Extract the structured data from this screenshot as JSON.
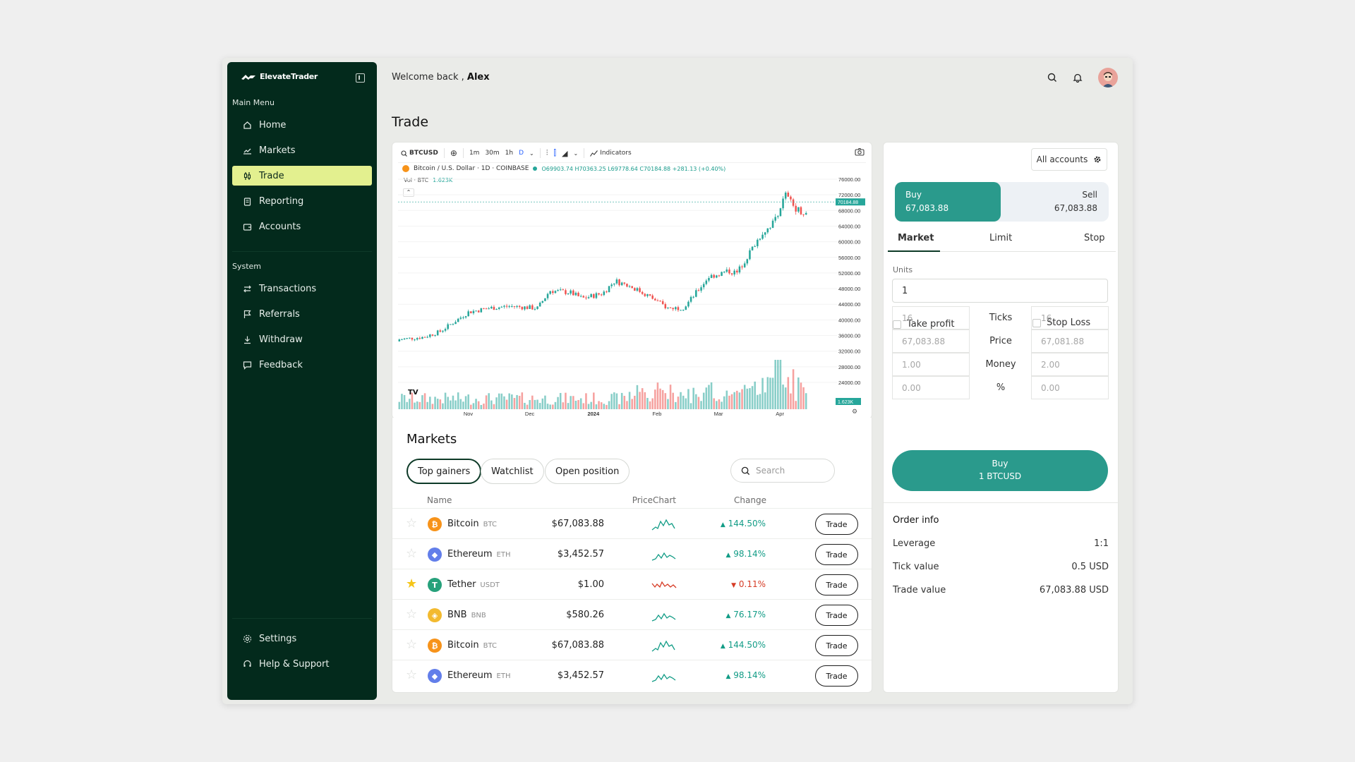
{
  "app": {
    "brand": "ElevateTrader"
  },
  "sidebar": {
    "main_menu_title": "Main Menu",
    "main_items": [
      {
        "label": "Home",
        "icon": "home-icon",
        "active": false
      },
      {
        "label": "Markets",
        "icon": "chart-line-icon",
        "active": false
      },
      {
        "label": "Trade",
        "icon": "candlestick-icon",
        "active": true
      },
      {
        "label": "Reporting",
        "icon": "clipboard-icon",
        "active": false
      },
      {
        "label": "Accounts",
        "icon": "wallet-icon",
        "active": false
      }
    ],
    "system_title": "System",
    "system_items": [
      {
        "label": "Transactions",
        "icon": "transfer-arrows-icon"
      },
      {
        "label": "Referrals",
        "icon": "flag-icon"
      },
      {
        "label": "Withdraw",
        "icon": "download-icon"
      },
      {
        "label": "Feedback",
        "icon": "message-icon"
      }
    ],
    "bottom_items": [
      {
        "label": "Settings",
        "icon": "gear-icon"
      },
      {
        "label": "Help & Support",
        "icon": "headset-icon"
      }
    ]
  },
  "topbar": {
    "welcome_prefix": "Welcome back ,",
    "user_name": "Alex"
  },
  "page": {
    "title": "Trade"
  },
  "chart": {
    "symbol": "BTCUSD",
    "intervals": [
      "1m",
      "30m",
      "1h",
      "D"
    ],
    "active_interval": "D",
    "indicators_label": "Indicators",
    "pair_name": "Bitcoin / U.S. Dollar · 1D · COINBASE",
    "ohlc": "O69903.74 H70363.25 L69778.64 C70184.88 +281.13 (+0.40%)",
    "volume_label": "Vol · BTC",
    "volume_value": "1.623K",
    "current_price_tag": "70184.88",
    "volume_tag": "1.623K",
    "x_ticks": [
      "Nov",
      "Dec",
      "2024",
      "Feb",
      "Mar",
      "Apr"
    ],
    "y_ticks": [
      "76000.00",
      "72000.00",
      "68000.00",
      "64000.00",
      "60000.00",
      "56000.00",
      "52000.00",
      "48000.00",
      "44000.00",
      "40000.00",
      "36000.00",
      "32000.00",
      "28000.00",
      "24000.00"
    ],
    "colors": {
      "up": "#26a69a",
      "down": "#ef5350"
    }
  },
  "markets": {
    "title": "Markets",
    "tabs": [
      "Top gainers",
      "Watchlist",
      "Open position"
    ],
    "search_placeholder": "Search",
    "columns": {
      "name": "Name",
      "price": "Price",
      "chart": "Chart",
      "change": "Change"
    },
    "trade_label": "Trade",
    "rows": [
      {
        "name": "Bitcoin",
        "ticker": "BTC",
        "price": "$67,083.88",
        "change": "144.50%",
        "direction": "up",
        "starred": false,
        "coin_color": "#f7931a",
        "coin_glyph": "₿"
      },
      {
        "name": "Ethereum",
        "ticker": "ETH",
        "price": "$3,452.57",
        "change": "98.14%",
        "direction": "up",
        "starred": false,
        "coin_color": "#627eea",
        "coin_glyph": "◆"
      },
      {
        "name": "Tether",
        "ticker": "USDT",
        "price": "$1.00",
        "change": "0.11%",
        "direction": "down",
        "starred": true,
        "coin_color": "#26a17b",
        "coin_glyph": "T"
      },
      {
        "name": "BNB",
        "ticker": "BNB",
        "price": "$580.26",
        "change": "76.17%",
        "direction": "up",
        "starred": false,
        "coin_color": "#f3ba2f",
        "coin_glyph": "◈"
      },
      {
        "name": "Bitcoin",
        "ticker": "BTC",
        "price": "$67,083.88",
        "change": "144.50%",
        "direction": "up",
        "starred": false,
        "coin_color": "#f7931a",
        "coin_glyph": "₿"
      },
      {
        "name": "Ethereum",
        "ticker": "ETH",
        "price": "$3,452.57",
        "change": "98.14%",
        "direction": "up",
        "starred": false,
        "coin_color": "#627eea",
        "coin_glyph": "◆"
      }
    ]
  },
  "order": {
    "accounts_label": "All accounts",
    "buy_label": "Buy",
    "buy_price": "67,083.88",
    "sell_label": "Sell",
    "sell_price": "67,083.88",
    "tabs": [
      "Market",
      "Limit",
      "Stop"
    ],
    "active_tab": "Market",
    "units_label": "Units",
    "units_value": "1",
    "take_profit_label": "Take profit",
    "stop_loss_label": "Stop Loss",
    "grid_labels": [
      "Ticks",
      "Price",
      "Money",
      "%"
    ],
    "take_profit_values": [
      "16",
      "67,083.88",
      "1.00",
      "0.00"
    ],
    "stop_loss_values": [
      "16",
      "67,081.88",
      "2.00",
      "0.00"
    ],
    "submit_line1": "Buy",
    "submit_line2": "1 BTCUSD",
    "info_title": "Order info",
    "info": [
      {
        "label": "Leverage",
        "value": "1:1"
      },
      {
        "label": "Tick value",
        "value": "0.5 USD"
      },
      {
        "label": "Trade value",
        "value": "67,083.88 USD"
      }
    ]
  }
}
